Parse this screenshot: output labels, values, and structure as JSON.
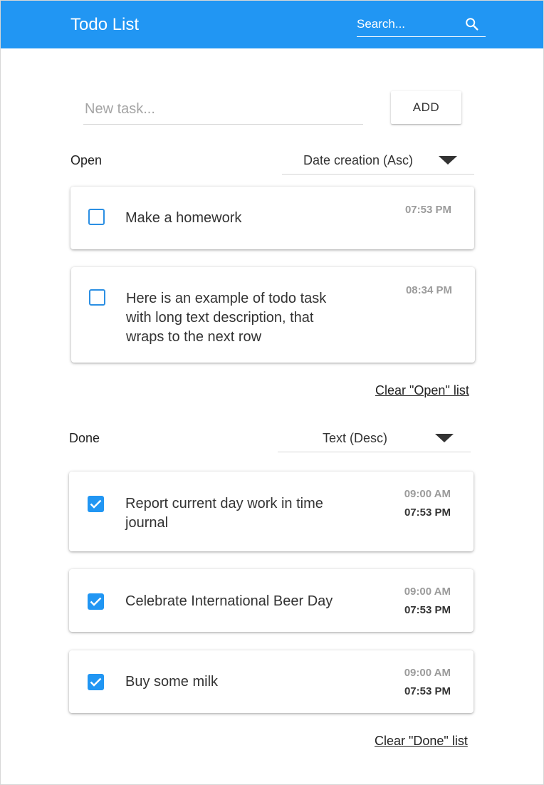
{
  "header": {
    "title": "Todo List",
    "search_placeholder": "Search...",
    "search_icon": "magnifier"
  },
  "new_task": {
    "placeholder": "New task...",
    "add_label": "ADD"
  },
  "open_section": {
    "label": "Open",
    "sort": "Date creation (Asc)",
    "tasks": [
      {
        "text": "Make a homework",
        "time": "07:53 PM",
        "checked": false
      },
      {
        "text": "Here is an example of todo task with long text description, that wraps to the next row",
        "time": "08:34 PM",
        "checked": false
      }
    ],
    "clear_label": "Clear \"Open\" list"
  },
  "done_section": {
    "label": "Done",
    "sort": "Text (Desc)",
    "tasks": [
      {
        "text": "Report current day work in time journal",
        "created": "09:00 AM",
        "done": "07:53 PM",
        "checked": true
      },
      {
        "text": "Celebrate International Beer Day",
        "created": "09:00 AM",
        "done": "07:53 PM",
        "checked": true
      },
      {
        "text": "Buy some milk",
        "created": "09:00 AM",
        "done": "07:53 PM",
        "checked": true
      }
    ],
    "clear_label": "Clear \"Done\" list"
  },
  "colors": {
    "primary": "#2196f3",
    "muted_text": "#9b9b9b"
  }
}
